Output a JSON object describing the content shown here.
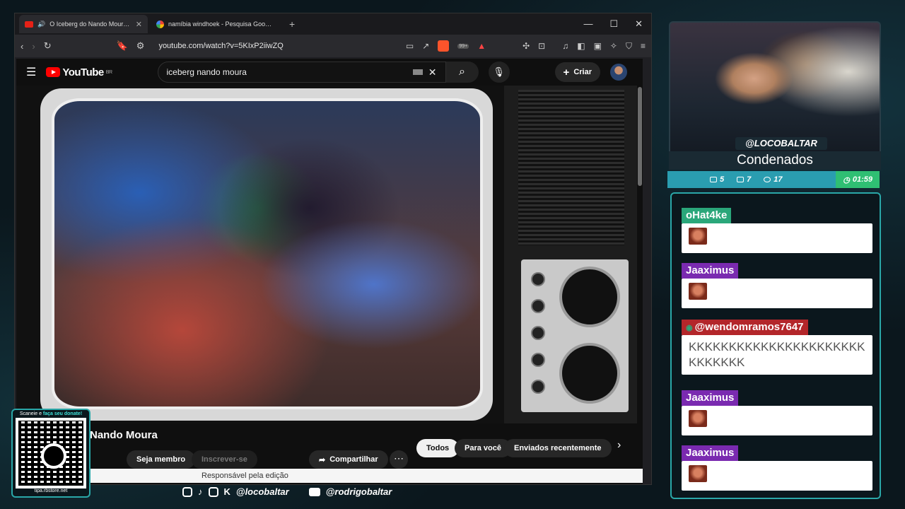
{
  "browser": {
    "tabs": [
      {
        "title": "O Iceberg do Nando Moura - YouTube",
        "active": true
      },
      {
        "title": "namíbia windhoek - Pesquisa Google",
        "active": false
      }
    ],
    "url": "youtube.com/watch?v=5KIxP2iiwZQ",
    "brave_badge": "99+"
  },
  "youtube": {
    "logo": "YouTube",
    "region": "BR",
    "search_value": "iceberg  nando moura",
    "create_label": "Criar",
    "channel_name": "Nando Moura",
    "member_label": "Seja membro",
    "subscribe_label": "Inscrever-se",
    "share_label": "Compartilhar",
    "chips": [
      "Todos",
      "Para você",
      "Enviados recentemente"
    ],
    "edit_notice": "Responsável pela edição"
  },
  "qr": {
    "top_text_plain": "Scaneie e ",
    "top_text_em": "faça seu donate!",
    "bottom_text": "tipa.rbstore.net"
  },
  "socials": {
    "handle1": "@locobaltar",
    "handle2": "@rodrigobaltar"
  },
  "stream": {
    "handle": "@LOCOBALTAR",
    "title": "Condenados",
    "stats": {
      "chat": "5",
      "youtube": "7",
      "viewers": "17",
      "timer": "01:59"
    }
  },
  "chat": {
    "messages": [
      {
        "user": "oHat4ke",
        "color": "#2aa77a",
        "text": ""
      },
      {
        "user": "Jaaximus",
        "color": "#7a2ab0",
        "text": ""
      },
      {
        "user": "@wendomramos7647",
        "color": "#b3262a",
        "text": "KKKKKKKKKKKKKKKKKKKKKKKKKKKKK"
      },
      {
        "user": "Jaaximus",
        "color": "#7a2ab0",
        "text": ""
      },
      {
        "user": "Jaaximus",
        "color": "#7a2ab0",
        "text": ""
      }
    ]
  }
}
